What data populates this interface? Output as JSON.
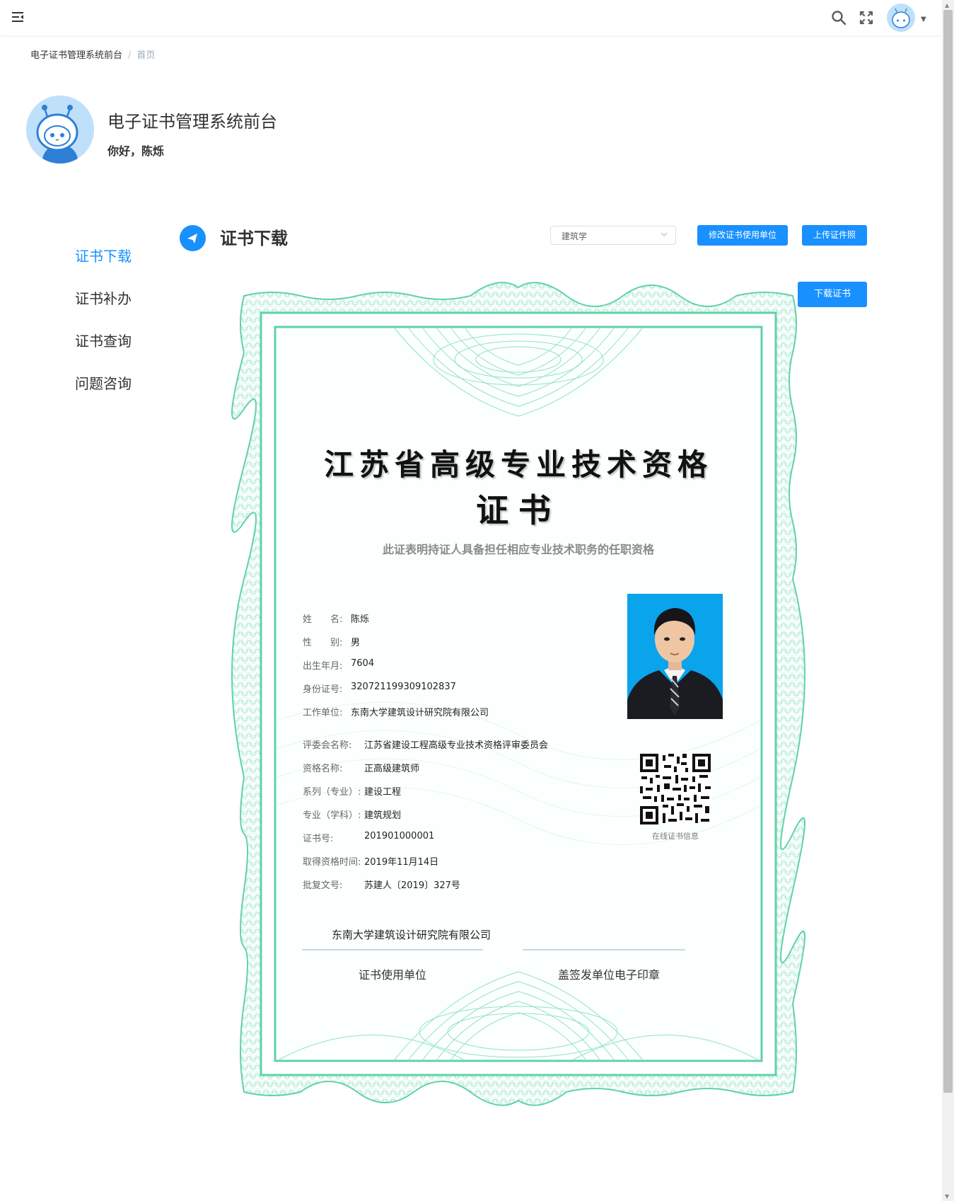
{
  "header": {
    "menu_icon": "hamburger-icon",
    "search_icon": "search-icon",
    "fullscreen_icon": "fullscreen-icon",
    "user_avatar": "robot-avatar",
    "caret_icon": "caret-down-icon"
  },
  "breadcrumb": {
    "items": [
      "电子证书管理系统前台",
      "首页"
    ],
    "separator": "/"
  },
  "profile": {
    "title": "电子证书管理系统前台",
    "greeting": "你好，陈烁"
  },
  "sidebar": {
    "items": [
      {
        "label": "证书下载",
        "active": true
      },
      {
        "label": "证书补办",
        "active": false
      },
      {
        "label": "证书查询",
        "active": false
      },
      {
        "label": "问题咨询",
        "active": false
      }
    ]
  },
  "section": {
    "icon": "send-icon",
    "title": "证书下载",
    "select_value": "建筑学",
    "edit_button": "修改证书使用单位",
    "upload_button": "上传证件照",
    "download_button": "下载证书"
  },
  "certificate": {
    "title_line1": "江苏省高级专业技术资格",
    "title_line2": "证书",
    "subtitle": "此证表明持证人具备担任相应专业技术职务的任职资格",
    "personal": [
      {
        "label": "姓　　名:",
        "value": "陈烁"
      },
      {
        "label": "性　　别:",
        "value": "男"
      },
      {
        "label": "出生年月:",
        "value": "7604"
      },
      {
        "label": "身份证号:",
        "value": "320721199309102837"
      },
      {
        "label": "工作单位:",
        "value": "东南大学建筑设计研究院有限公司"
      }
    ],
    "qualification": [
      {
        "label": "评委会名称:",
        "value": "江苏省建设工程高级专业技术资格评审委员会"
      },
      {
        "label": "资格名称:",
        "value": "正高级建筑师"
      },
      {
        "label": "系列（专业）:",
        "value": "建设工程"
      },
      {
        "label": "专业（学科）:",
        "value": "建筑规划"
      },
      {
        "label": "证书号:",
        "value": "201901000001"
      },
      {
        "label": "取得资格时间:",
        "value": "2019年11月14日"
      },
      {
        "label": "批复文号:",
        "value": "苏建人〔2019〕327号"
      }
    ],
    "qr_caption": "在线证书信息",
    "using_unit": "东南大学建筑设计研究院有限公司",
    "using_unit_caption": "证书使用单位",
    "seal_caption": "盖签发单位电子印章",
    "colors": {
      "border": "#5fd3a6",
      "pattern": "#8fe3c4",
      "photo_bg": "#0aa4ec"
    }
  },
  "colors": {
    "primary": "#1890ff",
    "text": "#303133",
    "muted": "#97a8be"
  }
}
